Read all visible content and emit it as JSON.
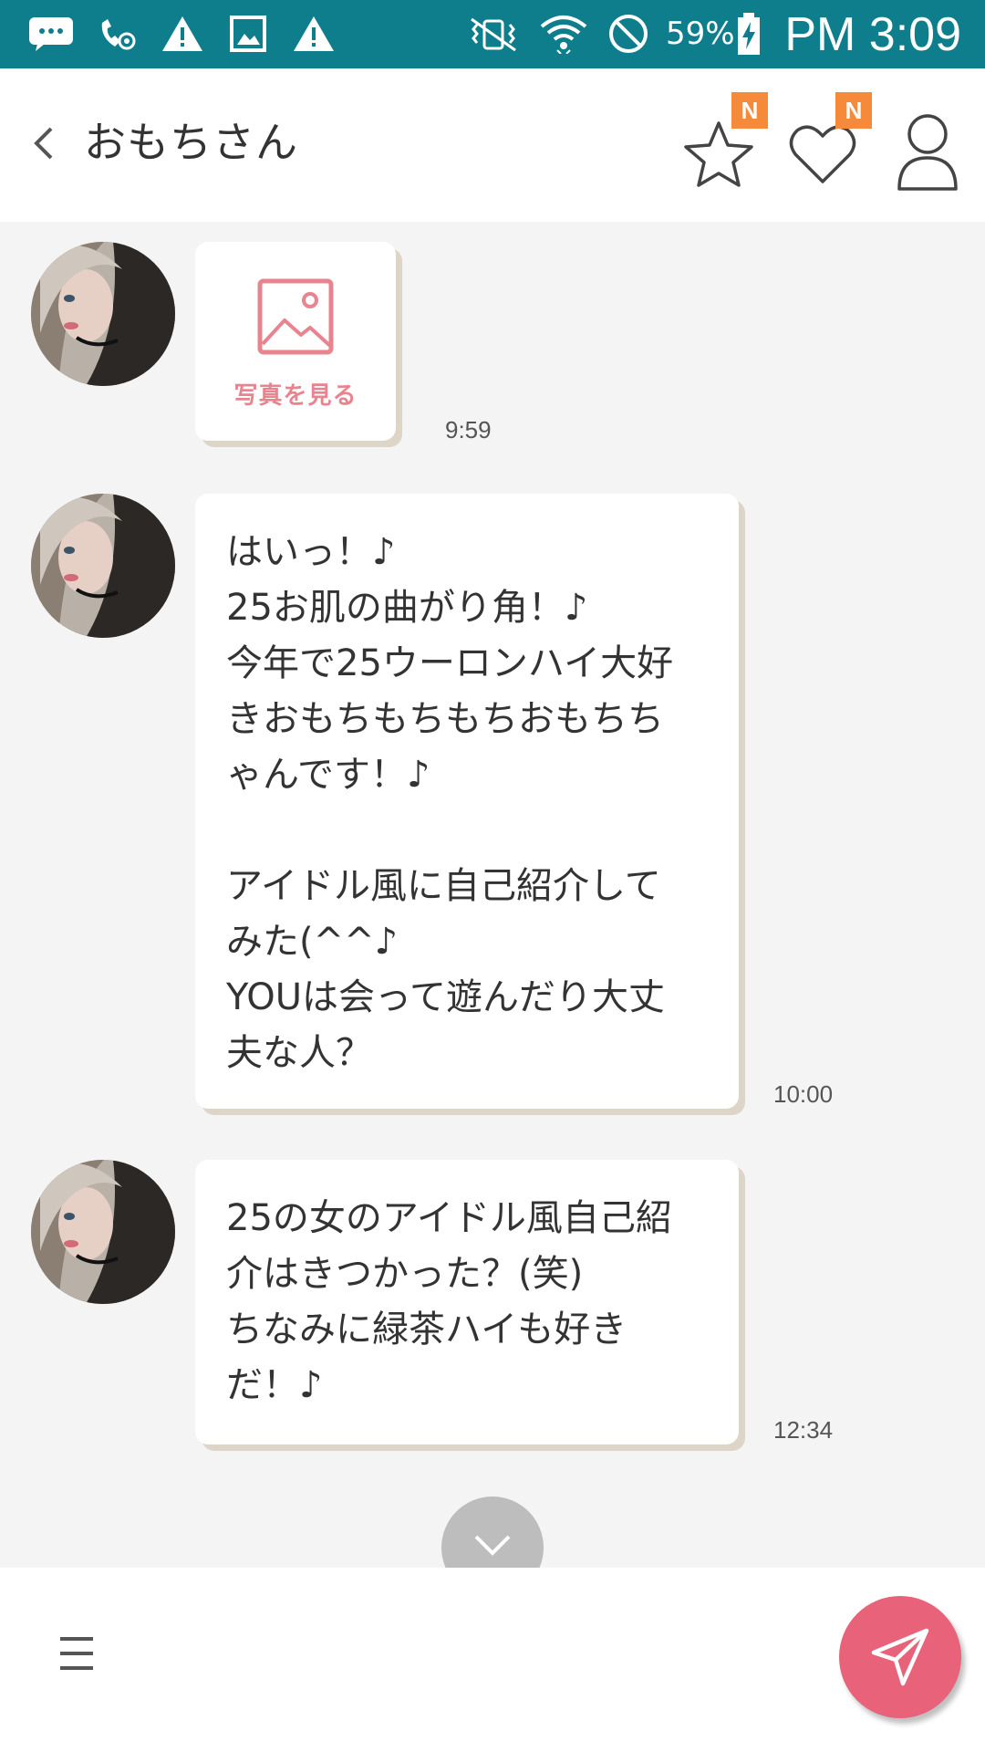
{
  "status_bar": {
    "battery_percent": "59%",
    "time": "PM 3:09",
    "icons": [
      "message-icon",
      "call-forwarding-icon",
      "warning-icon",
      "image-icon",
      "warning-icon",
      "vibrate-icon",
      "wifi-icon",
      "do-not-disturb-icon",
      "battery-charging-icon"
    ]
  },
  "header": {
    "title": "おもちさん",
    "favorite_badge": "N",
    "like_badge": "N"
  },
  "messages": [
    {
      "type": "photo",
      "photo_label": "写真を見る",
      "time": "9:59"
    },
    {
      "type": "text",
      "text": "はいっ！♪\n25お肌の曲がり角！♪\n今年で25ウーロンハイ大好\nきおもちもちもちおもちち\nゃんです！♪\n\nアイドル風に自己紹介して\nみた(^^♪\nYOUは会って遊んだり大丈\n夫な人？",
      "time": "10:00"
    },
    {
      "type": "text",
      "text": "25の女のアイドル風自己紹\n介はきつかった？(笑)\nちなみに緑茶ハイも好き\nだ！♪",
      "time": "12:34"
    }
  ],
  "colors": {
    "status_bar": "#0e7e8c",
    "badge": "#f58a3b",
    "send_button": "#e8637a",
    "photo_accent": "#e8848f",
    "chat_background": "#f4f4f4",
    "bubble_shadow": "#ddd5c8"
  }
}
